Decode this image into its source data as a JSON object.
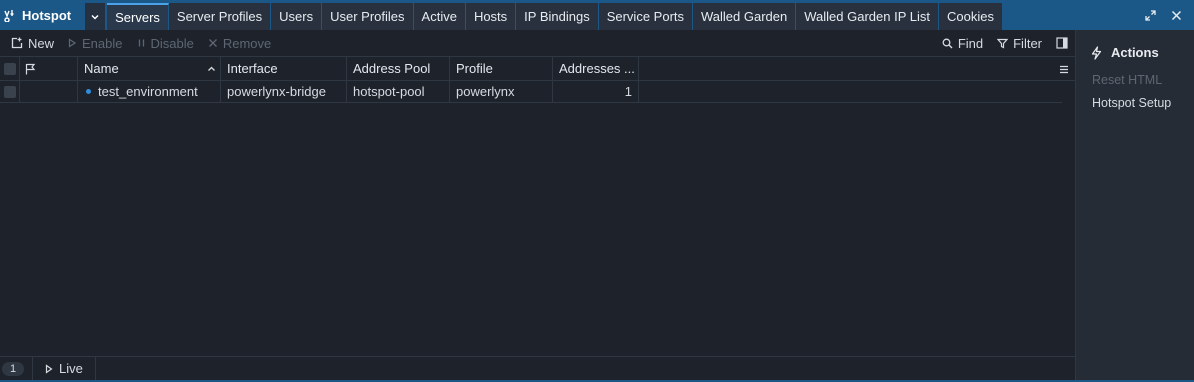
{
  "app": {
    "title": "Hotspot"
  },
  "tabs": [
    {
      "label": "Servers",
      "active": true
    },
    {
      "label": "Server Profiles"
    },
    {
      "label": "Users"
    },
    {
      "label": "User Profiles"
    },
    {
      "label": "Active"
    },
    {
      "label": "Hosts"
    },
    {
      "label": "IP Bindings"
    },
    {
      "label": "Service Ports"
    },
    {
      "label": "Walled Garden"
    },
    {
      "label": "Walled Garden IP List"
    },
    {
      "label": "Cookies"
    }
  ],
  "toolbar": {
    "new": "New",
    "enable": "Enable",
    "disable": "Disable",
    "remove": "Remove",
    "find": "Find",
    "filter": "Filter"
  },
  "grid": {
    "columns": [
      "Name",
      "Interface",
      "Address Pool",
      "Profile",
      "Addresses ..."
    ],
    "rows": [
      {
        "name": "test_environment",
        "interface": "powerlynx-bridge",
        "address_pool": "hotspot-pool",
        "profile": "powerlynx",
        "addresses": "1"
      }
    ]
  },
  "footer": {
    "count": "1",
    "live": "Live"
  },
  "actions": {
    "title": "Actions",
    "items": [
      {
        "label": "Reset HTML",
        "enabled": false
      },
      {
        "label": "Hotspot Setup",
        "enabled": true
      }
    ]
  },
  "colors": {
    "accent": "#1b5887",
    "active_tab_border": "#4aa3e8",
    "status_dot": "#2f8ee0"
  }
}
